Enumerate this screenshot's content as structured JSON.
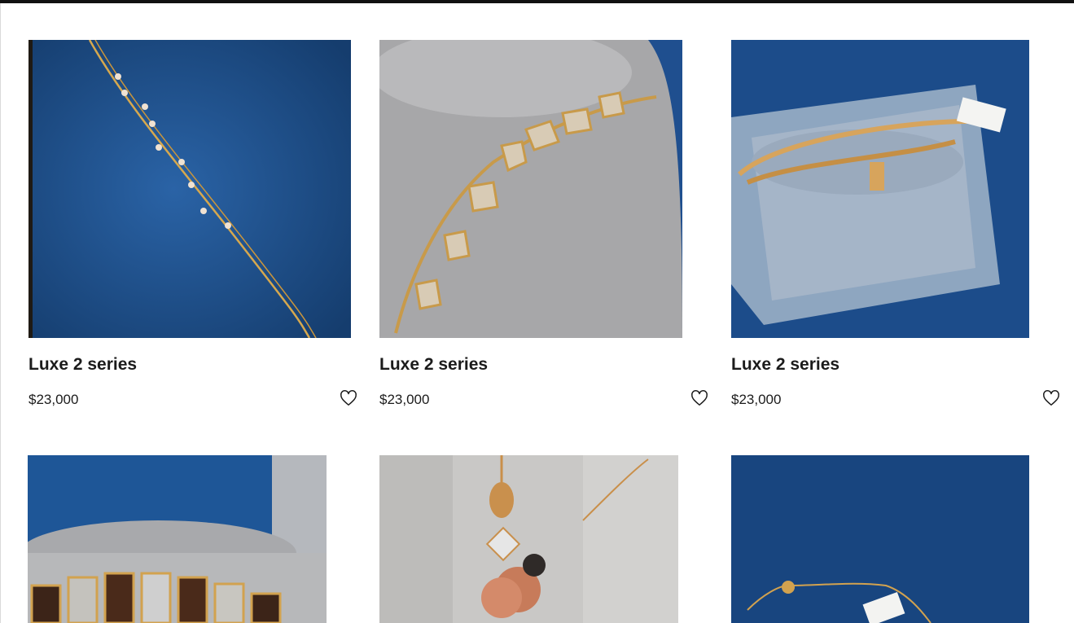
{
  "products": [
    {
      "title": "Luxe 2 series",
      "price": "$23,000",
      "image": "gold-pearl-chain-bracelet",
      "wishlist_icon": "heart-outline-icon"
    },
    {
      "title": "Luxe 2 series",
      "price": "$23,000",
      "image": "uncut-diamond-gold-bracelet",
      "wishlist_icon": "heart-outline-icon"
    },
    {
      "title": "Luxe 2 series",
      "price": "$23,000",
      "image": "gold-nail-bangle",
      "wishlist_icon": "heart-outline-icon"
    },
    {
      "image": "gold-silver-link-bracelet"
    },
    {
      "image": "rose-gold-flower-charm-bracelet"
    },
    {
      "image": "gold-slider-chain-bracelet"
    }
  ],
  "colors": {
    "velvet_blue": "#1d4f8c",
    "cushion_grey": "#a8a8a8",
    "gold": "#d4a457",
    "text": "#1b1b1b",
    "top_bar": "#111111"
  }
}
